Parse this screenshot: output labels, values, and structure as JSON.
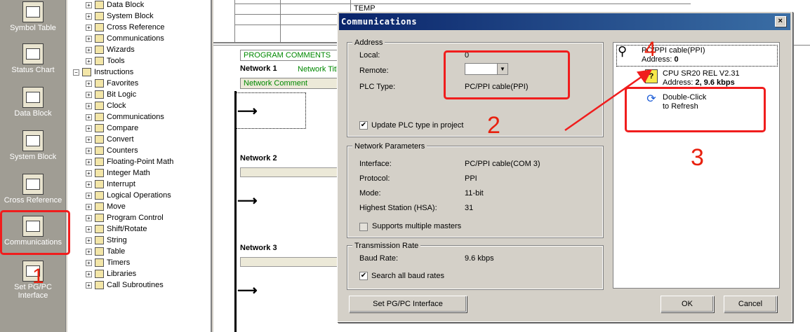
{
  "nav": {
    "items": [
      {
        "label": "Symbol Table",
        "icon": "symbol-table-icon"
      },
      {
        "label": "Status Chart",
        "icon": "status-chart-icon"
      },
      {
        "label": "Data Block",
        "icon": "data-block-icon"
      },
      {
        "label": "System Block",
        "icon": "system-block-icon"
      },
      {
        "label": "Cross Reference",
        "icon": "cross-reference-icon"
      },
      {
        "label": "Communications",
        "icon": "communications-icon"
      },
      {
        "label": "Set PG/PC Interface",
        "icon": "set-pgpc-interface-icon"
      }
    ]
  },
  "tree": {
    "top": [
      "Data Block",
      "System Block",
      "Cross Reference",
      "Communications",
      "Wizards",
      "Tools"
    ],
    "instructions_label": "Instructions",
    "instructions": [
      "Favorites",
      "Bit Logic",
      "Clock",
      "Communications",
      "Compare",
      "Convert",
      "Counters",
      "Floating-Point Math",
      "Integer Math",
      "Interrupt",
      "Logical Operations",
      "Move",
      "Program Control",
      "Shift/Rotate",
      "String",
      "Table",
      "Timers",
      "Libraries",
      "Call Subroutines"
    ]
  },
  "editor": {
    "temp1": "TEMP",
    "temp2": "TEMP",
    "program_comments": "PROGRAM COMMENTS",
    "network1": "Network 1",
    "network_title": "Network Title",
    "network_comment": "Network Comment",
    "network2": "Network 2",
    "network3": "Network 3"
  },
  "dialog": {
    "title": "Communications",
    "close": "×",
    "address": {
      "group": "Address",
      "local_label": "Local:",
      "local_value": "0",
      "remote_label": "Remote:",
      "remote_value": "",
      "plc_type_label": "PLC Type:",
      "plc_type_value": "PC/PPI cable(PPI)",
      "update_label": "Update PLC type in project",
      "update_checked": "✔"
    },
    "network": {
      "group": "Network Parameters",
      "interface_label": "Interface:",
      "interface_value": "PC/PPI cable(COM 3)",
      "protocol_label": "Protocol:",
      "protocol_value": "PPI",
      "mode_label": "Mode:",
      "mode_value": "11-bit",
      "hsa_label": "Highest Station (HSA):",
      "hsa_value": "31",
      "multimaster_label": "Supports multiple masters"
    },
    "transmission": {
      "group": "Transmission Rate",
      "baud_label": "Baud Rate:",
      "baud_value": "9.6 kbps",
      "all_baud_label": "Search all baud rates",
      "all_baud_checked": "✔"
    },
    "panel": {
      "cable_name": "PC/PPI cable(PPI)",
      "cable_address_prefix": "Address: ",
      "cable_address": "0",
      "cpu_name": "CPU SR20 REL V2.31",
      "cpu_address_prefix": "Address: ",
      "cpu_address": "2, 9.6 kbps",
      "refresh_line1": "Double-Click",
      "refresh_line2": "to Refresh"
    },
    "buttons": {
      "set_pgpc": "Set PG/PC Interface",
      "ok": "OK",
      "cancel": "Cancel"
    }
  },
  "annotations": {
    "n1": "1",
    "n2": "2",
    "n3": "3",
    "n4": "4",
    "color": "#f01d1d"
  }
}
